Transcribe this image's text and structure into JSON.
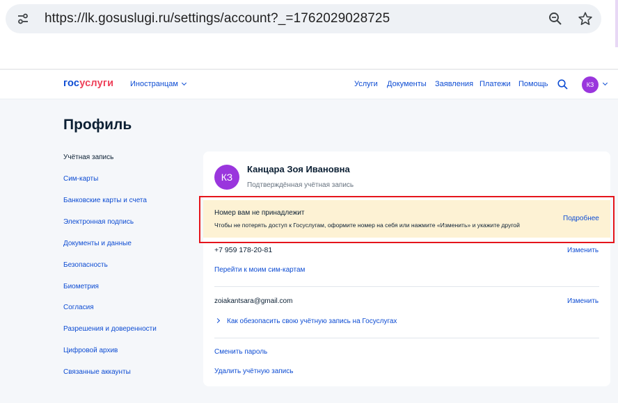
{
  "browser": {
    "url": "https://lk.gosuslugi.ru/settings/account?_=1762029028725",
    "icons": [
      "tune-icon",
      "zoom-icon",
      "star-icon"
    ]
  },
  "header": {
    "logo_part1": "гос",
    "logo_part2": "услуги",
    "lang": "Иностранцам",
    "nav": [
      "Услуги",
      "Документы",
      "Заявления",
      "Платежи",
      "Помощь"
    ],
    "avatar_initials": "КЗ"
  },
  "page": {
    "title": "Профиль"
  },
  "sidebar": {
    "items": [
      "Учётная запись",
      "Сим-карты",
      "Банковские карты и счета",
      "Электронная подпись",
      "Документы и данные",
      "Безопасность",
      "Биометрия",
      "Согласия",
      "Разрешения и доверенности",
      "Цифровой архив",
      "Связанные аккаунты"
    ]
  },
  "account": {
    "initials": "КЗ",
    "name": "Канцара Зоя Ивановна",
    "status": "Подтверждённая учётная запись",
    "warning_title": "Номер вам не принадлежит",
    "warning_text": "Чтобы не потерять доступ к Госуслугам, оформите номер на себя или нажмите «Изменить» и укажите другой",
    "warning_link": "Подробнее",
    "phone": "+7 959 178-20-81",
    "phone_edit": "Изменить",
    "sim_link": "Перейти к моим сим-картам",
    "email": "zoiakantsara@gmail.com",
    "email_edit": "Изменить",
    "secure_link": "Как обезопасить свою учётную запись на Госуслугах",
    "change_password": "Сменить пароль",
    "delete_account": "Удалить учётную запись"
  },
  "colors": {
    "brand_blue": "#0d4cd3",
    "brand_red": "#ee3f58",
    "avatar": "#9a36dd",
    "warning_bg": "#fdf2d4",
    "highlight_border": "#e5141b"
  }
}
